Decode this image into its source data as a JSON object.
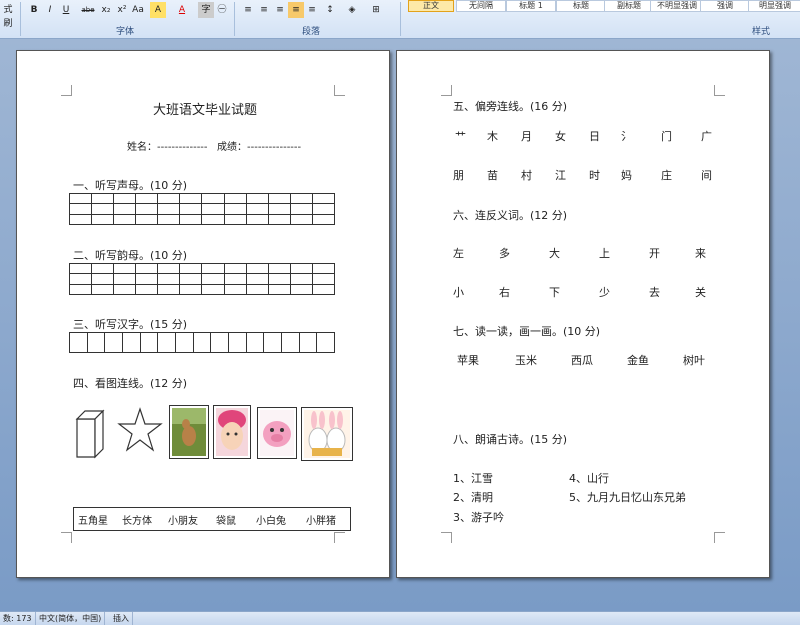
{
  "ribbon": {
    "left_cut_label": "式刷",
    "font_buttons": [
      "B",
      "I",
      "U",
      "abe",
      "x₂",
      "x²",
      "Aa",
      "A",
      "A",
      "字"
    ],
    "font_group": "字体",
    "para_group": "段落",
    "styles_group": "样式",
    "style_gallery": [
      "正文",
      "无间隔",
      "标题 1",
      "标题",
      "副标题",
      "不明显强调",
      "强调",
      "明显强调"
    ]
  },
  "left_page": {
    "title": "大班语文毕业试题",
    "name_line": "姓名：--------------",
    "score_line": "成绩：---------------",
    "section1": "一、听写声母。(10 分)",
    "section2": "二、听写韵母。(10 分)",
    "section3": "三、听写汉字。(15 分)",
    "section4": "四、看图连线。(12 分)",
    "word_box": [
      "五角星",
      "长方体",
      "小朋友",
      "袋鼠",
      "小白兔",
      "小胖猪"
    ],
    "images": [
      "cuboid-icon",
      "star-icon",
      "kangaroo-photo",
      "baby-photo",
      "pig-toy-photo",
      "bunny-toys-photo"
    ]
  },
  "right_page": {
    "section5": "五、偏旁连线。(16 分)",
    "radicals": [
      "艹",
      "木",
      "月",
      "女",
      "日",
      "氵",
      "门",
      "广"
    ],
    "radical_words": [
      "朋",
      "苗",
      "村",
      "江",
      "时",
      "妈",
      "庄",
      "间"
    ],
    "section6": "六、连反义词。(12 分)",
    "antonym_row1": [
      "左",
      "多",
      "大",
      "上",
      "开",
      "来"
    ],
    "antonym_row2": [
      "小",
      "右",
      "下",
      "少",
      "去",
      "关"
    ],
    "section7": "七、读一读，画一画。(10 分)",
    "draw_words": [
      "苹果",
      "玉米",
      "西瓜",
      "金鱼",
      "树叶"
    ],
    "section8": "八、朗诵古诗。(15 分)",
    "poems": [
      "1、江雪",
      "4、山行",
      "2、清明",
      "5、九月九日忆山东兄弟",
      "3、游子吟"
    ]
  },
  "statusbar": {
    "words": "数: 173",
    "language": "中文(简体，中国)",
    "mode": "插入"
  },
  "colors": {
    "ribbon_bg": "#dbe7f6",
    "workspace_bg": "#8fa8c8",
    "page_bg": "#ffffff"
  }
}
